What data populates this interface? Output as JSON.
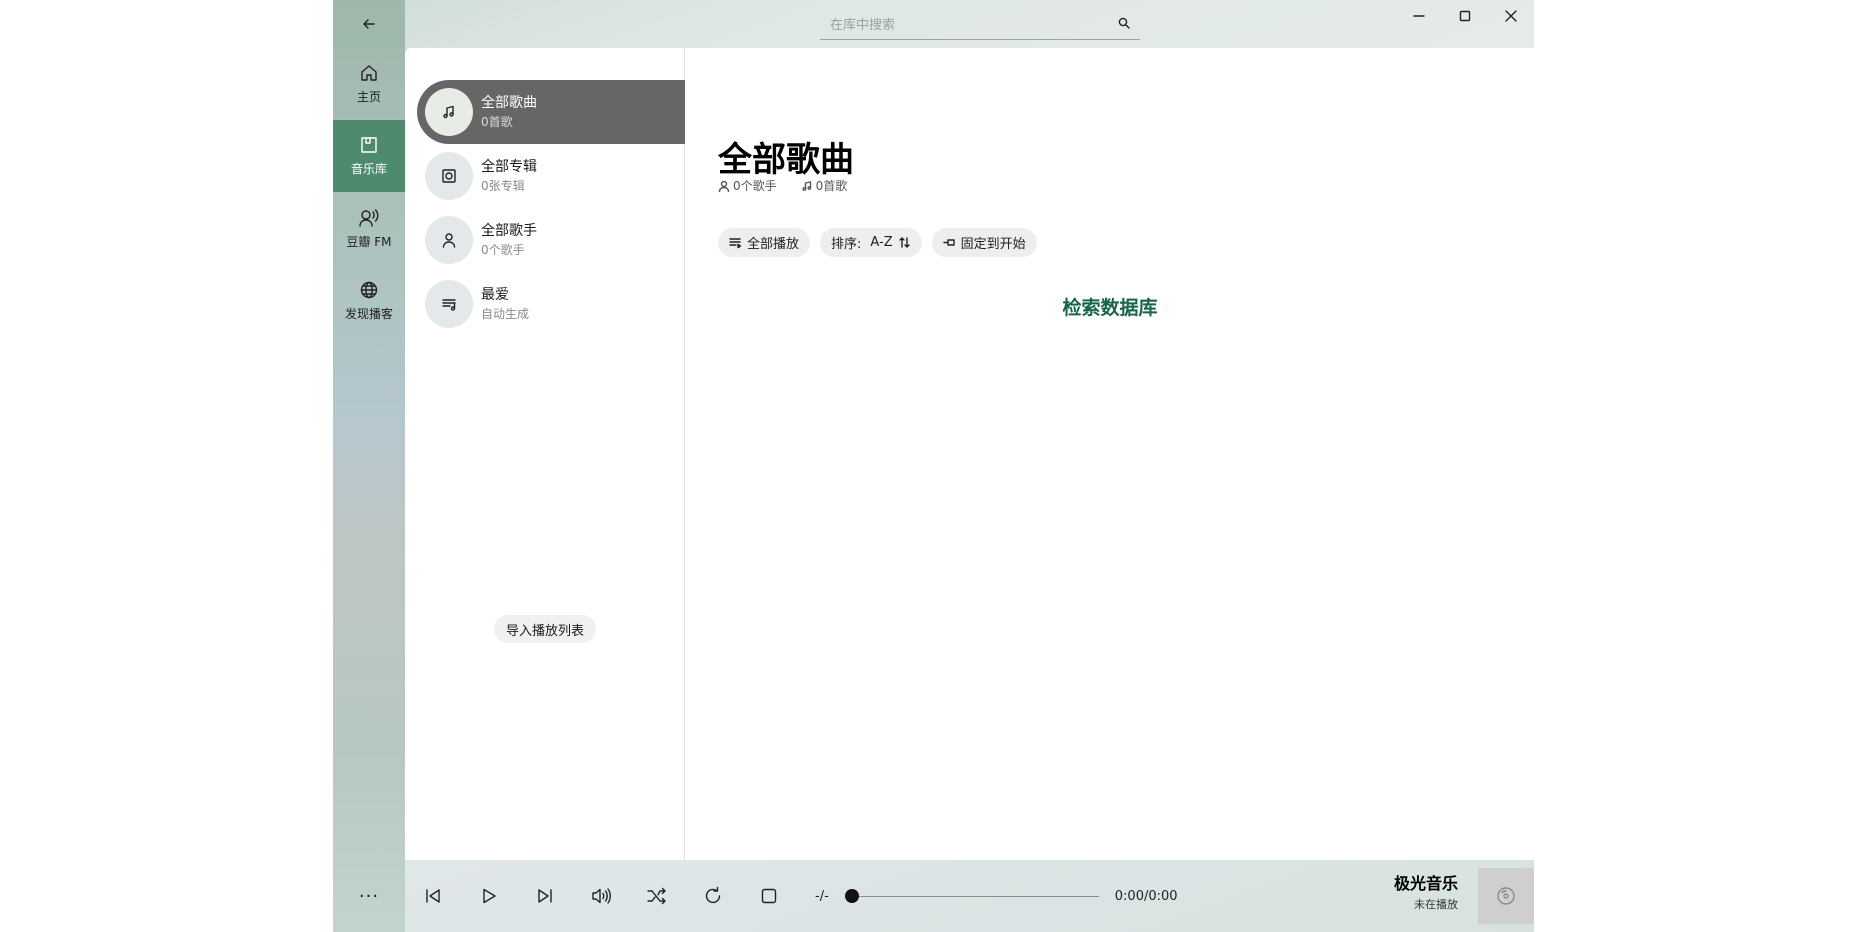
{
  "nav": {
    "items": [
      {
        "label": "主页",
        "icon": "home-icon"
      },
      {
        "label": "音乐库",
        "icon": "library-icon",
        "active": true
      },
      {
        "label": "豆瓣 FM",
        "icon": "radio-icon"
      },
      {
        "label": "发现播客",
        "icon": "globe-icon"
      }
    ],
    "more_label": "···"
  },
  "search": {
    "placeholder": "在库中搜索"
  },
  "categories": [
    {
      "title": "全部歌曲",
      "subtitle": "0首歌",
      "icon": "music-note-icon",
      "active": true
    },
    {
      "title": "全部专辑",
      "subtitle": "0张专辑",
      "icon": "album-icon"
    },
    {
      "title": "全部歌手",
      "subtitle": "0个歌手",
      "icon": "person-icon"
    },
    {
      "title": "最爱",
      "subtitle": "自动生成",
      "icon": "playlist-icon"
    }
  ],
  "import_label": "导入播放列表",
  "main": {
    "title": "全部歌曲",
    "artists_count": "0个歌手",
    "songs_count": "0首歌",
    "play_all": "全部播放",
    "sort_label": "排序:",
    "sort_value": "A-Z",
    "pin_label": "固定到开始",
    "status": "检索数据库"
  },
  "player": {
    "speed": "-/-",
    "time": "0:00/0:00",
    "progress": 0,
    "app_name": "极光音乐",
    "status": "未在播放"
  },
  "colors": {
    "accent": "#4d8a6e",
    "status_link": "#17654a",
    "active_item_bg": "#666666"
  }
}
